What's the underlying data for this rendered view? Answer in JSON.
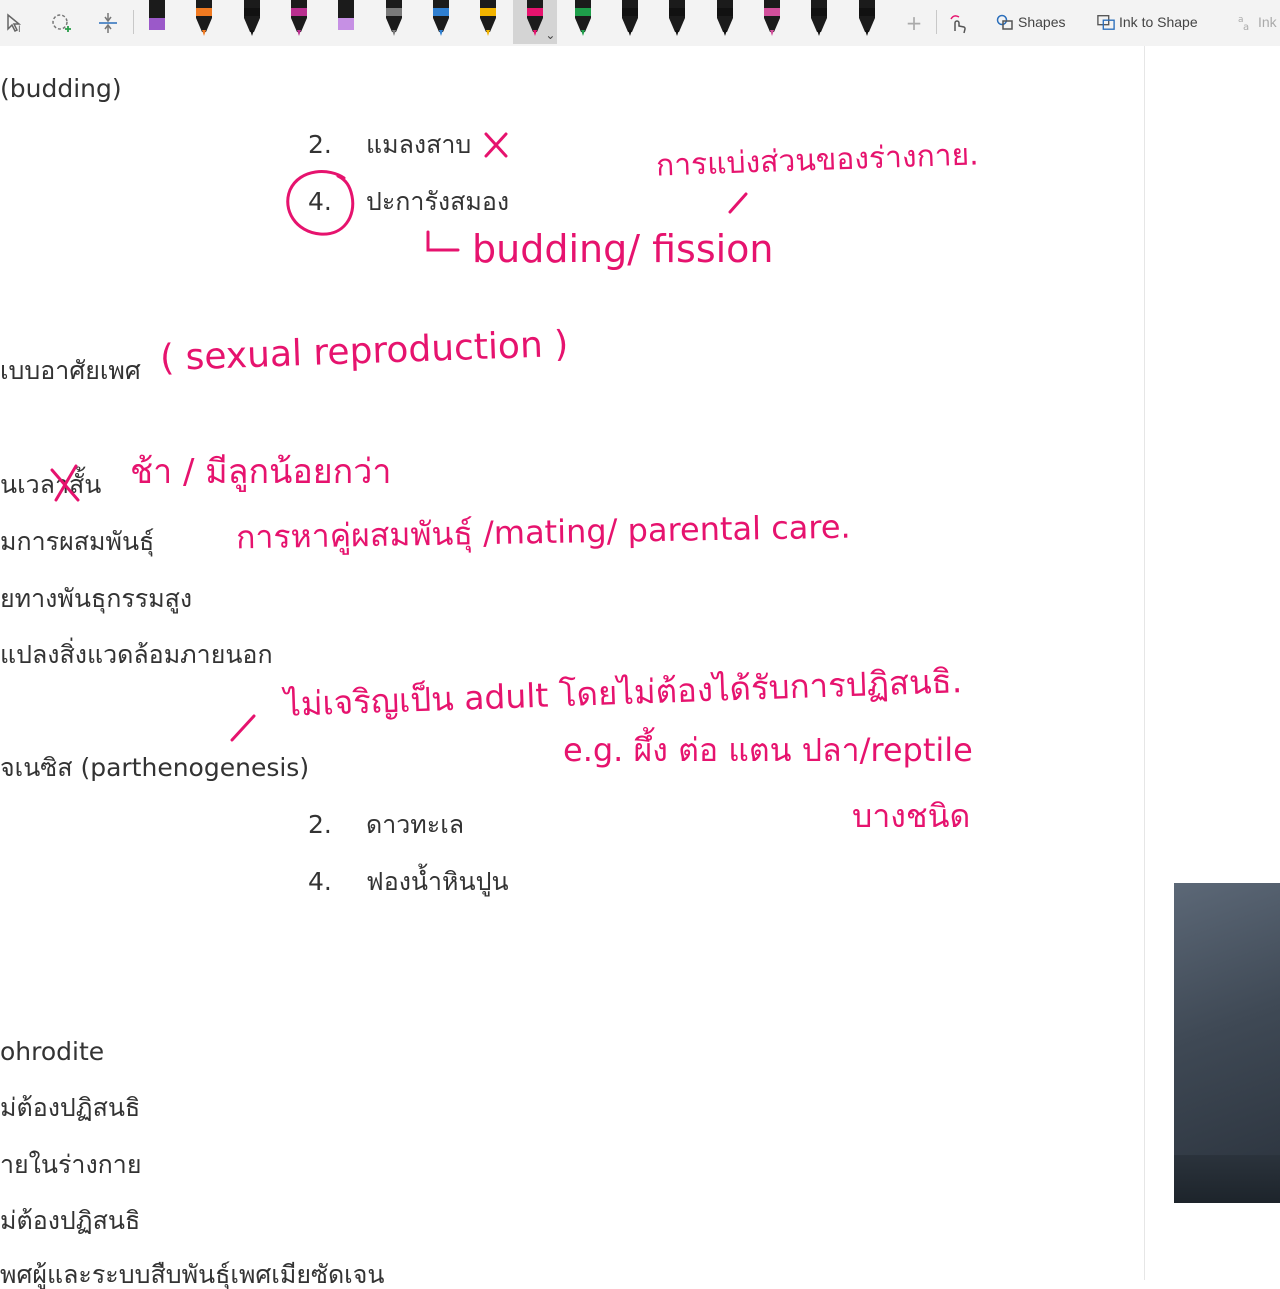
{
  "toolbar": {
    "shapes_label": "Shapes",
    "ink_to_shape_label": "Ink to Shape",
    "ink_to_text_label": "Ink",
    "pens": [
      {
        "icon": "highlighter-icon",
        "color": "#9b59c9"
      },
      {
        "icon": "pen-icon",
        "color": "#f07a21"
      },
      {
        "icon": "pen-icon",
        "color": "#111111"
      },
      {
        "icon": "pen-icon",
        "color": "#b9308f"
      },
      {
        "icon": "highlighter-icon",
        "color": "#c690e4"
      },
      {
        "icon": "pen-icon",
        "color": "#7a7a7a"
      },
      {
        "icon": "pen-icon",
        "color": "#2f7fd1"
      },
      {
        "icon": "pen-icon",
        "color": "#f2b400"
      },
      {
        "icon": "pen-icon",
        "color": "#e6136e"
      },
      {
        "icon": "pen-icon",
        "color": "#1e9e4a"
      },
      {
        "icon": "pen-icon",
        "color": "#111111"
      },
      {
        "icon": "pen-icon",
        "color": "#111111"
      },
      {
        "icon": "pen-icon",
        "color": "#111111"
      },
      {
        "icon": "pen-icon",
        "color": "#d14f9b"
      },
      {
        "icon": "pen-icon",
        "color": "#111111"
      },
      {
        "icon": "pen-icon",
        "color": "#111111"
      }
    ],
    "selected_pen_index": 8
  },
  "doc": {
    "lines": [
      {
        "id": "budding",
        "text": "(budding)"
      },
      {
        "id": "opt2a",
        "text": "2."
      },
      {
        "id": "opt2a_text",
        "text": "แมลงสาบ"
      },
      {
        "id": "opt4a",
        "text": "4."
      },
      {
        "id": "opt4a_text",
        "text": "ปะการังสมอง"
      },
      {
        "id": "sexual",
        "text": "เบบอาศัยเพศ"
      },
      {
        "id": "l1",
        "text": "นเวลาสั้น"
      },
      {
        "id": "l2",
        "text": "มการผสมพันธุ์"
      },
      {
        "id": "l3",
        "text": "ยทางพันธุกรรมสูง"
      },
      {
        "id": "l4",
        "text": "แปลงสิ่งแวดล้อมภายนอก"
      },
      {
        "id": "parth",
        "text": "จเนซิส (parthenogenesis)"
      },
      {
        "id": "opt2b",
        "text": "2."
      },
      {
        "id": "opt2b_text",
        "text": "ดาวทะเล"
      },
      {
        "id": "opt4b",
        "text": "4."
      },
      {
        "id": "opt4b_text",
        "text": "ฟองน้ำหินปูน"
      },
      {
        "id": "herm",
        "text": "ohrodite"
      },
      {
        "id": "h1",
        "text": "ม่ต้องปฏิสนธิ"
      },
      {
        "id": "h2",
        "text": "ายในร่างกาย"
      },
      {
        "id": "h3",
        "text": "ม่ต้องปฏิสนธิ"
      },
      {
        "id": "h4",
        "text": "พศผู้และระบบสืบพันธุ์เพศเมียซัดเจน"
      }
    ]
  },
  "ink": {
    "color": "#e6136e",
    "notes": [
      {
        "id": "n1",
        "text": "การแบ่งส่วนของร่างกาย."
      },
      {
        "id": "n2",
        "text": "budding/ fission"
      },
      {
        "id": "n3",
        "text": "( sexual reproduction )"
      },
      {
        "id": "n4",
        "text": "ช้า / มีลูกน้อยกว่า"
      },
      {
        "id": "n5",
        "text": "การหาคู่ผสมพันธุ์ /mating/ parental care."
      },
      {
        "id": "n6",
        "text": "ไม่เจริญเป็น adult โดยไม่ต้องได้รับการปฏิสนธิ."
      },
      {
        "id": "n7",
        "text": "e.g. ผึ้ง ต่อ แตน  ปลา/reptile"
      },
      {
        "id": "n8",
        "text": "บางชนิด"
      }
    ]
  }
}
